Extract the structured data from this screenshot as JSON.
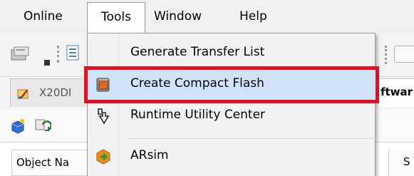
{
  "menubar": {
    "items": [
      {
        "label": "Online"
      },
      {
        "label": "Tools"
      },
      {
        "label": "Window"
      },
      {
        "label": "Help"
      }
    ]
  },
  "tab": {
    "left_label": "X20DI",
    "right_label": "ftwar"
  },
  "table": {
    "col_object": "Object Na",
    "col_s": "S"
  },
  "dropdown": {
    "items": [
      {
        "label": "Generate Transfer List",
        "icon": "none"
      },
      {
        "label": "Create Compact Flash",
        "icon": "compact-flash-icon",
        "highlighted": true
      },
      {
        "label": "Runtime Utility Center",
        "icon": "runtime-utility-icon"
      },
      {
        "label": "ARsim",
        "icon": "arsim-icon"
      }
    ]
  },
  "colors": {
    "highlight": "#cfe4f8",
    "annotation_red": "#e3101f"
  }
}
